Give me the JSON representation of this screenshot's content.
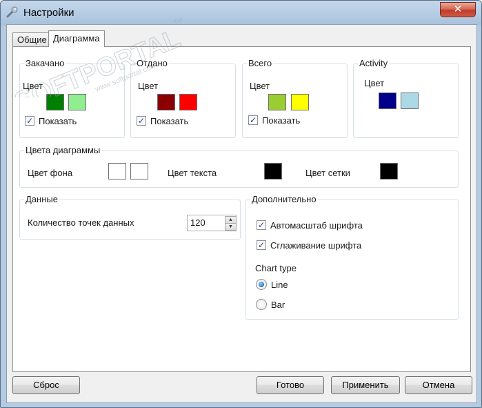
{
  "window": {
    "title": "Настройки",
    "close_symbol": "✕"
  },
  "tabs": [
    {
      "label": "Общие",
      "active": false
    },
    {
      "label": "Диаграмма",
      "active": true
    }
  ],
  "groups": {
    "downloaded": {
      "title": "Закачано",
      "color_label": "Цвет",
      "show_label": "Показать",
      "show_checked": true,
      "colors": [
        "#008000",
        "#90ee90"
      ]
    },
    "uploaded": {
      "title": "Отдано",
      "color_label": "Цвет",
      "show_label": "Показать",
      "show_checked": true,
      "colors": [
        "#8b0000",
        "#ff0000"
      ]
    },
    "total": {
      "title": "Всего",
      "color_label": "Цвет",
      "show_label": "Показать",
      "show_checked": true,
      "colors": [
        "#9acd32",
        "#ffff00"
      ]
    },
    "activity": {
      "title": "Activity",
      "color_label": "Цвет",
      "colors": [
        "#00008b",
        "#add8e6"
      ]
    }
  },
  "chart_colors": {
    "title": "Цвета диаграммы",
    "background_label": "Цвет фона",
    "background_colors": [
      "#ffffff",
      "#ffffff"
    ],
    "text_label": "Цвет текста",
    "text_color": "#000000",
    "grid_label": "Цвет сетки",
    "grid_color": "#000000"
  },
  "data_group": {
    "title": "Данные",
    "points_label": "Количество точек данных",
    "points_value": "120"
  },
  "advanced": {
    "title": "Дополнительно",
    "autoscale_label": "Автомасштаб шрифта",
    "autoscale_checked": true,
    "smoothing_label": "Сглаживание шрифта",
    "smoothing_checked": true,
    "chart_type_label": "Chart type",
    "chart_type_options": [
      "Line",
      "Bar"
    ],
    "chart_type_selected": "Line"
  },
  "buttons": {
    "reset": "Сброс",
    "ok": "Готово",
    "apply": "Применить",
    "cancel": "Отмена"
  },
  "watermark": {
    "text": "SOFTPORTAL",
    "url": "www.softportal.com",
    "tm": "TM"
  }
}
